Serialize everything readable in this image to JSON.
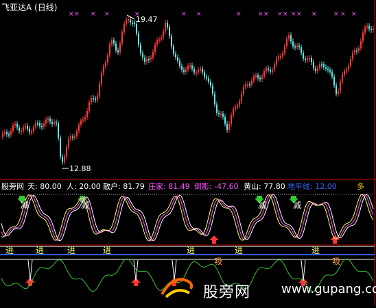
{
  "title": {
    "label": "飞亚达A (日线)"
  },
  "price_labels": {
    "high": "19.47",
    "low": "12.88"
  },
  "indicators": {
    "source": "股旁网",
    "tian": "天: 80.00",
    "ren": "人: 20.00",
    "sanhu": "散户: 81.79",
    "zhuangjia": "庄家: 81.49",
    "daoying": "倒影: -47.60",
    "huangshan": "黄山: 77.80",
    "diping": "地平线: 12.00",
    "more": "多"
  },
  "signals": {
    "reduce": "减",
    "enter": "进",
    "suck": "吸"
  },
  "watermark": {
    "text": "股旁网",
    "url": "www.gupang.com"
  },
  "colors": {
    "up": "#ff3b3b",
    "down": "#66e6e6",
    "white_line": "#ffffff",
    "magenta": "#ff55ff",
    "yellow": "#ffff00",
    "blue": "#2e5bff",
    "green": "#33cc33",
    "red": "#ff3333"
  },
  "chart_data": {
    "type": "candlestick",
    "price_range": [
      12.88,
      19.47
    ],
    "indicator_levels": {
      "tian": 80.0,
      "ren": 20.0,
      "sanhu": 81.79,
      "zhuangjia": 81.49,
      "daoying": -47.6,
      "huangshan": 77.8,
      "diping": 12.0
    }
  }
}
